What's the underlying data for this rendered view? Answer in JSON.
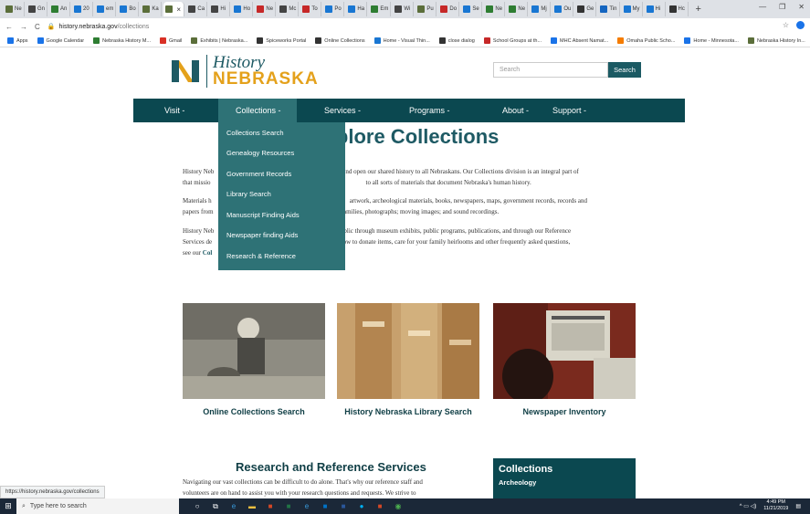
{
  "browser": {
    "tabs": [
      "Ne",
      "Gn",
      "An",
      "20",
      "em",
      "Bo",
      "Ka",
      "",
      "Ca",
      "Hi",
      "Ho",
      "Ne",
      "Mc",
      "To",
      "Po",
      "Ha",
      "Em",
      "Wi",
      "Pu",
      "Do",
      "Se",
      "Ne",
      "Ne",
      "Mj",
      "Ou",
      "Ge",
      "Tin",
      "My",
      "Hi",
      "Hc"
    ],
    "new_tab": "+",
    "url_host": "history.nebraska.gov",
    "url_path": "/collections",
    "bookmarks": [
      "Apps",
      "Google Calendar",
      "Nebraska History M...",
      "Gmail",
      "Exhibits | Nebraska...",
      "Spiceworks Portal",
      "Online Collections",
      "Home - Visual Thin...",
      "close dialog",
      "School Groups at th...",
      "MHC Absent Namat...",
      "Omaha Public Scho...",
      "Home - Minnesota...",
      "Nebraska History In..."
    ],
    "status_url": "https://history.nebraska.gov/collections"
  },
  "site": {
    "logo_line1": "History",
    "logo_line2": "NEBRASKA",
    "search_placeholder": "Search",
    "search_button": "Search",
    "nav": [
      "Visit -",
      "Collections -",
      "Services -",
      "Programs -",
      "About -",
      "Support -"
    ],
    "dropdown": [
      "Collections Search",
      "Genealogy Resources",
      "Government Records",
      "Library Search",
      "Manuscript Finding Aids",
      "Newspaper finding Aids",
      "Research & Reference"
    ],
    "title": "Explore Collections",
    "para1_a": "History Neb",
    "para1_b": "nd open our shared history to all Nebraskans. Our Collections division is an integral part of",
    "para1_c": "that missio",
    "para1_d": "to all sorts of materials that document Nebraska's human history.",
    "para2_a": "Materials h",
    "para2_b": "artwork, archeological materials, books, newspapers, maps, government records, records and",
    "para2_c": "papers from",
    "para2_d": "families, photographs; moving images; and sound recordings.",
    "para3_a": "History Neb",
    "para3_b": "public through museum exhibits, public programs, publications, and through our Reference",
    "para3_c": "Services de",
    "para3_d": "how to donate items, care for your family heirlooms and other frequently asked questions,",
    "para3_e": "see our",
    "para3_link": "Col",
    "tiles": [
      "Online Collections Search",
      "History Nebraska Library Search",
      "Newspaper Inventory"
    ],
    "research_title": "Research and Reference Services",
    "research_text1": "Navigating our vast collections can be difficult to do alone. That's why our reference staff and",
    "research_text2": "volunteers are on hand to assist you with your research questions and requests. We strive to",
    "sidebox_title": "Collections",
    "sidebox_item": "Archeology"
  },
  "taskbar": {
    "search_placeholder": "Type here to search",
    "time": "4:49 PM",
    "date": "11/21/2019"
  },
  "colors": {
    "teal_dark": "#0b4850",
    "teal_mid": "#2e7276",
    "gold": "#e4a11b"
  }
}
